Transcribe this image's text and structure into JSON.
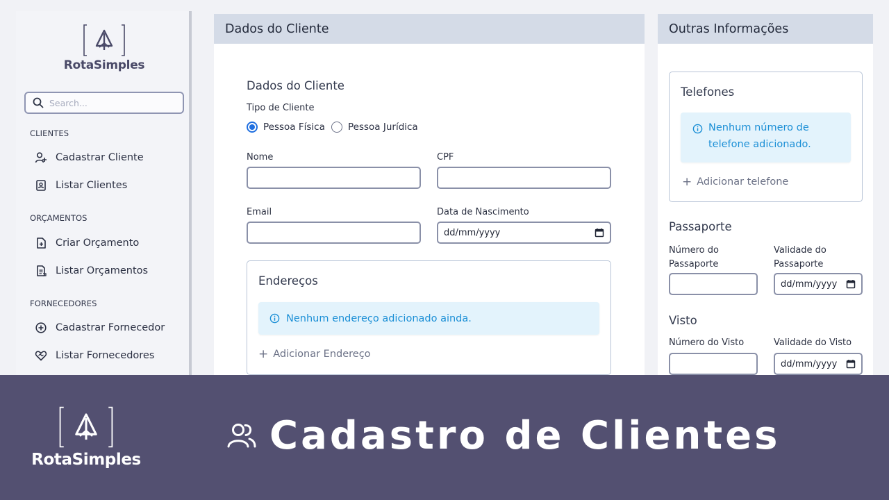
{
  "brand": {
    "name": "RotaSimples"
  },
  "search": {
    "placeholder": "Search..."
  },
  "sidebar": {
    "sections": [
      {
        "title": "CLIENTES",
        "items": [
          {
            "label": "Cadastrar Cliente",
            "icon": "user-plus-icon"
          },
          {
            "label": "Listar Clientes",
            "icon": "address-book-icon"
          }
        ]
      },
      {
        "title": "ORÇAMENTOS",
        "items": [
          {
            "label": "Criar Orçamento",
            "icon": "file-plus-icon"
          },
          {
            "label": "Listar Orçamentos",
            "icon": "file-list-icon"
          }
        ]
      },
      {
        "title": "FORNECEDORES",
        "items": [
          {
            "label": "Cadastrar Fornecedor",
            "icon": "circle-plus-icon"
          },
          {
            "label": "Listar Fornecedores",
            "icon": "handshake-heart-icon"
          }
        ]
      }
    ]
  },
  "main": {
    "header": "Dados do Cliente",
    "section_title": "Dados do Cliente",
    "tipo_label": "Tipo de Cliente",
    "tipo_options": [
      "Pessoa Física",
      "Pessoa Jurídica"
    ],
    "tipo_selected": "Pessoa Física",
    "fields": {
      "nome": {
        "label": "Nome",
        "value": ""
      },
      "cpf": {
        "label": "CPF",
        "value": ""
      },
      "email": {
        "label": "Email",
        "value": ""
      },
      "nascimento": {
        "label": "Data de Nascimento",
        "value": "dd/mm/yyyy"
      }
    },
    "enderecos": {
      "title": "Endereços",
      "empty_message": "Nenhum endereço adicionado ainda.",
      "add_label": "Adicionar Endereço"
    }
  },
  "side": {
    "header": "Outras Informações",
    "telefones": {
      "title": "Telefones",
      "empty_message_line1": "Nenhum número de",
      "empty_message_line2": "telefone adicionado.",
      "add_label": "Adicionar telefone"
    },
    "passaporte": {
      "title": "Passaporte",
      "numero_label_line1": "Número do",
      "numero_label_line2": "Passaporte",
      "validade_label_line1": "Validade do",
      "validade_label_line2": "Passaporte",
      "numero_value": "",
      "validade_value": "dd/mm/yyyy"
    },
    "visto": {
      "title": "Visto",
      "numero_label": "Número do Visto",
      "validade_label": "Validade do Visto",
      "numero_value": "",
      "validade_value": "dd/mm/yyyy"
    }
  },
  "banner": {
    "brand": "RotaSimples",
    "title": "Cadastro de Clientes",
    "icon": "users-icon",
    "background": "#535071"
  },
  "colors": {
    "accent": "#1f6fe0",
    "info": "#1b8fd6",
    "header_bg": "#d4dbe7"
  }
}
